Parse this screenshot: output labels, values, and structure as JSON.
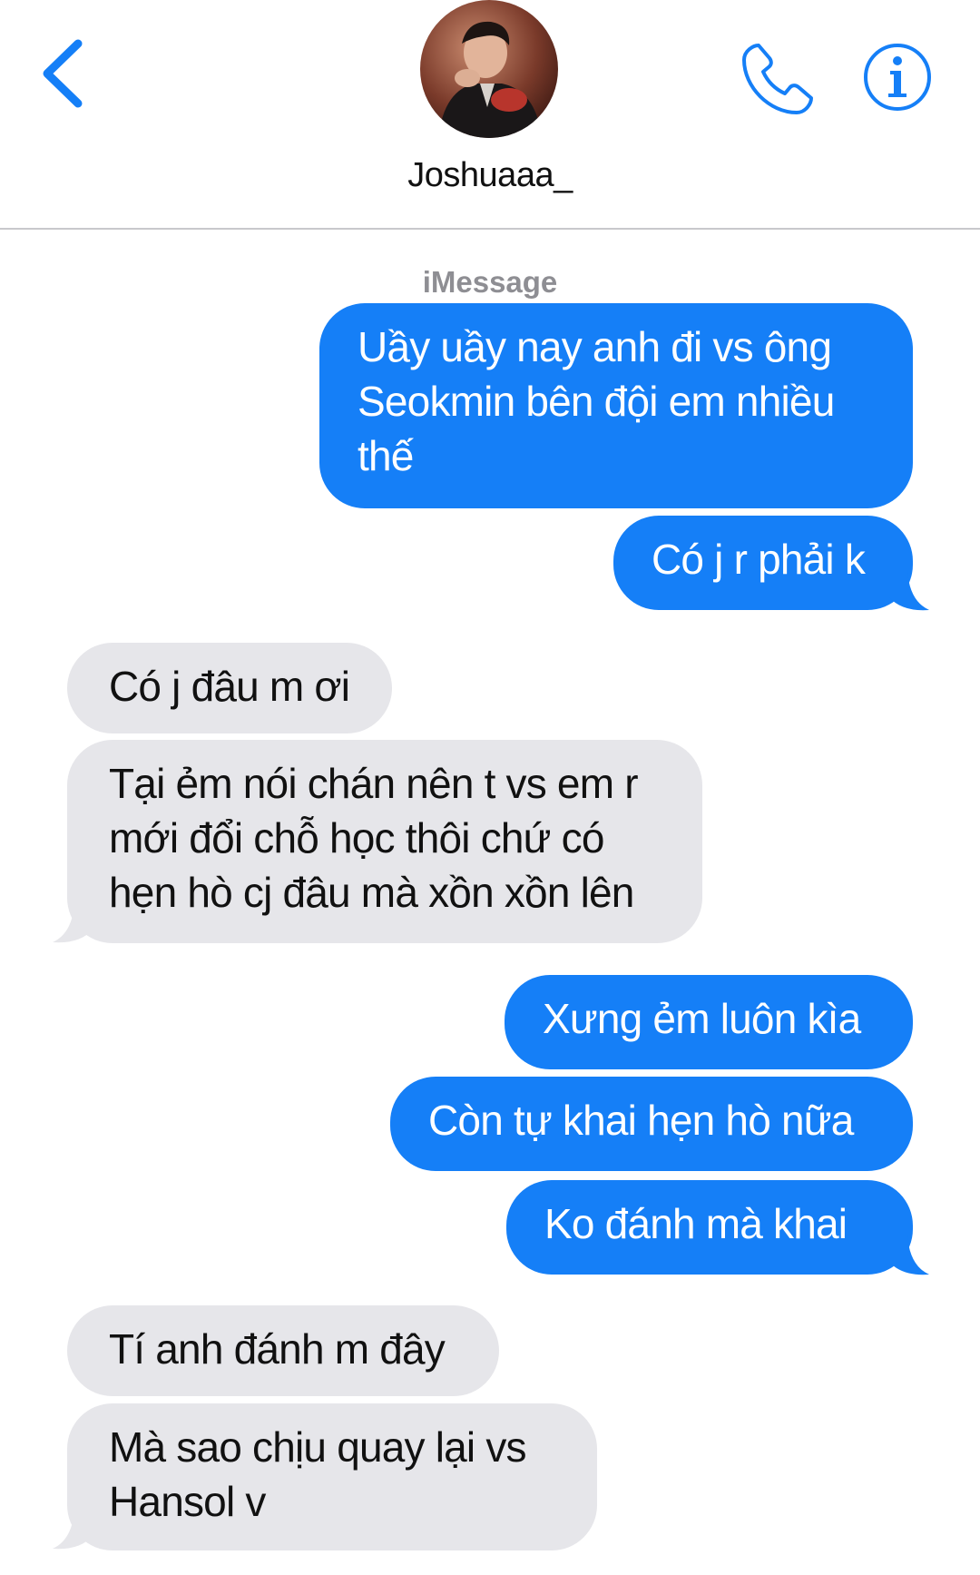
{
  "header": {
    "contact_name": "Joshuaaa_",
    "back_icon": "chevron-left-icon",
    "call_icon": "phone-icon",
    "info_icon": "info-icon"
  },
  "conversation": {
    "service_label": "iMessage",
    "messages": [
      {
        "sender": "me",
        "lines": [
          "Uầy uầy nay anh đi vs ông",
          "Seokmin bên đội em nhiều",
          "thế"
        ]
      },
      {
        "sender": "me",
        "lines": [
          "Có j r phải k"
        ]
      },
      {
        "sender": "contact",
        "lines": [
          "Có j đâu m ơi"
        ]
      },
      {
        "sender": "contact",
        "lines": [
          "Tại ẻm nói chán nên t vs em r",
          "mới đổi chỗ học thôi chứ có",
          "hẹn hò cj đâu mà xồn xồn lên"
        ]
      },
      {
        "sender": "me",
        "lines": [
          "Xưng ẻm luôn kìa"
        ]
      },
      {
        "sender": "me",
        "lines": [
          "Còn tự khai hẹn hò nữa"
        ]
      },
      {
        "sender": "me",
        "lines": [
          "Ko đánh mà khai"
        ]
      },
      {
        "sender": "contact",
        "lines": [
          "Tí anh đánh m đây"
        ]
      },
      {
        "sender": "contact",
        "lines": [
          "Mà sao chịu quay lại vs",
          "Hansol v"
        ]
      }
    ]
  },
  "colors": {
    "sent_bubble": "#157ff7",
    "received_bubble": "#e6e6ea",
    "accent": "#157ff7"
  }
}
